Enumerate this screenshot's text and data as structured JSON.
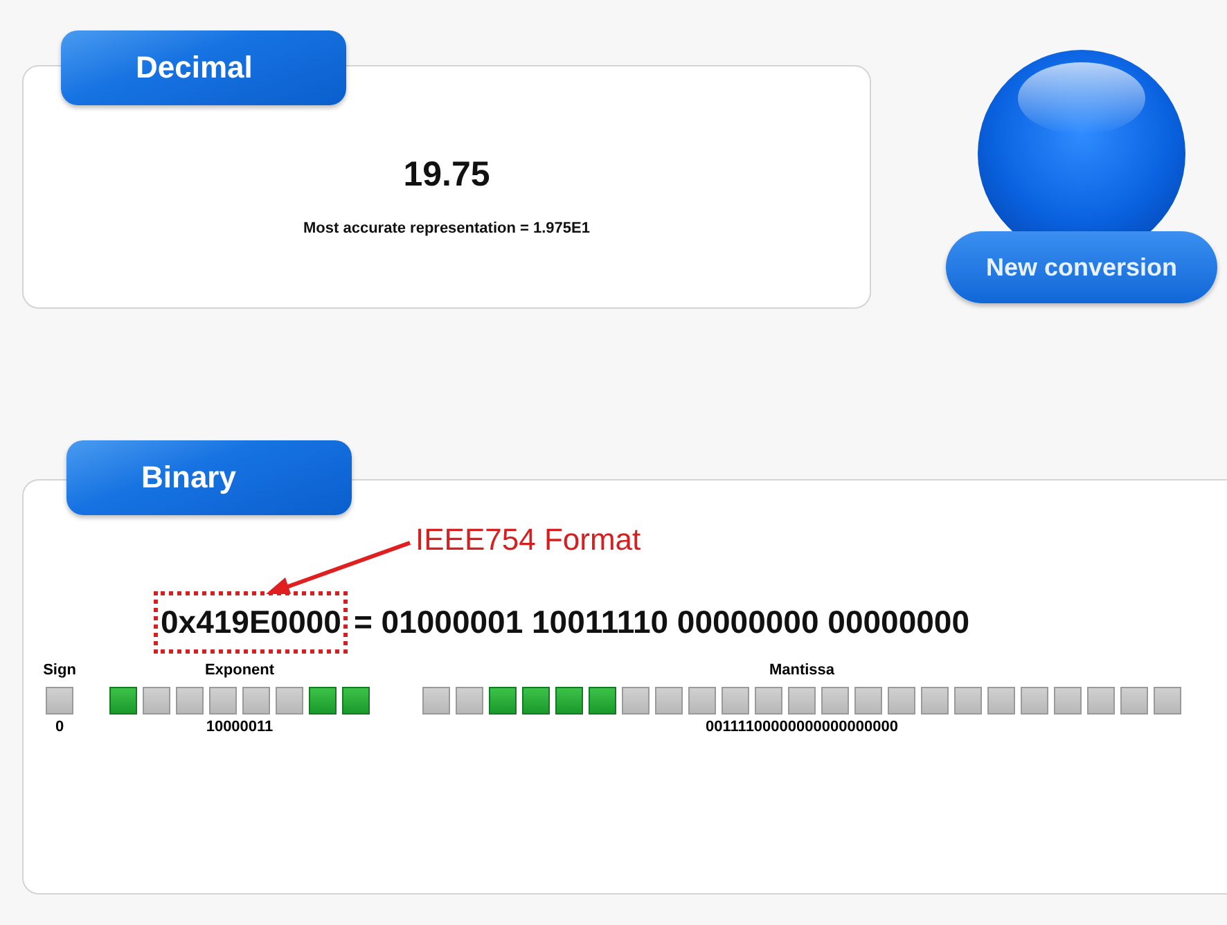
{
  "decimal_panel": {
    "tab": "Decimal",
    "value": "19.75",
    "representation": "Most accurate representation = 1.975E1"
  },
  "new_conversion_button": {
    "label": "New conversion"
  },
  "binary_panel": {
    "tab": "Binary",
    "annotation": "IEEE754 Format",
    "hex": "0x419E0000",
    "equation": "= 01000001 10011110 00000000 00000000",
    "fields": [
      {
        "label": "Sign",
        "reading": "0",
        "bits": [
          {
            "on": false
          }
        ]
      },
      {
        "label": "Exponent",
        "reading": "10000011",
        "bits": [
          {
            "on": true
          },
          {
            "on": false
          },
          {
            "on": false
          },
          {
            "on": false
          },
          {
            "on": false
          },
          {
            "on": false
          },
          {
            "on": true
          },
          {
            "on": true
          }
        ]
      },
      {
        "label": "Mantissa",
        "reading": "00111100000000000000000",
        "bits": [
          {
            "on": false
          },
          {
            "on": false
          },
          {
            "on": true
          },
          {
            "on": true
          },
          {
            "on": true
          },
          {
            "on": true
          },
          {
            "on": false
          },
          {
            "on": false
          },
          {
            "on": false
          },
          {
            "on": false
          },
          {
            "on": false
          },
          {
            "on": false
          },
          {
            "on": false
          },
          {
            "on": false
          },
          {
            "on": false
          },
          {
            "on": false
          },
          {
            "on": false
          },
          {
            "on": false
          },
          {
            "on": false
          },
          {
            "on": false
          },
          {
            "on": false
          },
          {
            "on": false
          },
          {
            "on": false
          }
        ]
      }
    ]
  }
}
